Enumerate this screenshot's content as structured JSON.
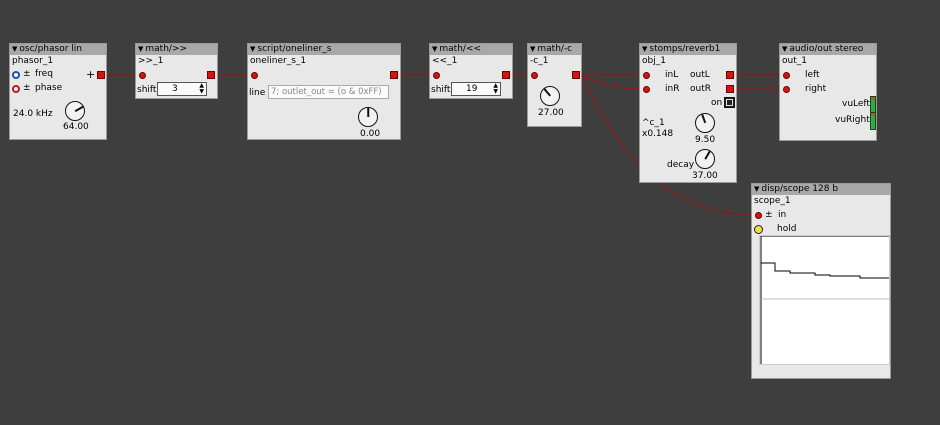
{
  "colors": {
    "background": "#3e3e3e",
    "wire": "#8a1a1a",
    "pin": "#d41414",
    "header": "#a8a8a8",
    "body": "#e8e8e8"
  },
  "objects": {
    "phasor": {
      "type": "osc/phasor lin",
      "name": "phasor_1",
      "freq_label": "freq",
      "phase_label": "phase",
      "pm": "±",
      "plus": "+",
      "freq_display": "24.0 kHz",
      "knob_value": "64.00"
    },
    "shr": {
      "type": "math/>>",
      "name": ">>_1",
      "shift_label": "shift",
      "shift_value": "3"
    },
    "oneliner": {
      "type": "script/oneliner_s",
      "name": "oneliner_s_1",
      "line_label": "line",
      "line_value": "7; outlet_out = (o & 0xFF)",
      "knob_value": "0.00"
    },
    "shl": {
      "type": "math/<<",
      "name": "<<_1",
      "shift_label": "shift",
      "shift_value": "19"
    },
    "minus": {
      "type": "math/-c",
      "name": "-c_1",
      "knob_value": "27.00"
    },
    "reverb": {
      "type": "stomps/reverb1",
      "name": "obj_1",
      "inL": "inL",
      "inR": "inR",
      "outL": "outL",
      "outR": "outR",
      "on_label": "on",
      "param_c_label": "^c_1",
      "param_c_value": "x0.148",
      "knob_c_value": "9.50",
      "decay_label": "decay",
      "decay_value": "37.00"
    },
    "out": {
      "type": "audio/out stereo",
      "name": "out_1",
      "left": "left",
      "right": "right",
      "vuLeft": "vuLeft",
      "vuRight": "vuRight"
    },
    "scope": {
      "type": "disp/scope 128 b",
      "name": "scope_1",
      "in_label": "in",
      "pm": "±",
      "hold_label": "hold"
    }
  },
  "icons": {
    "collapse": "triangle-down-icon",
    "spin": "spinner-arrows-icon"
  }
}
